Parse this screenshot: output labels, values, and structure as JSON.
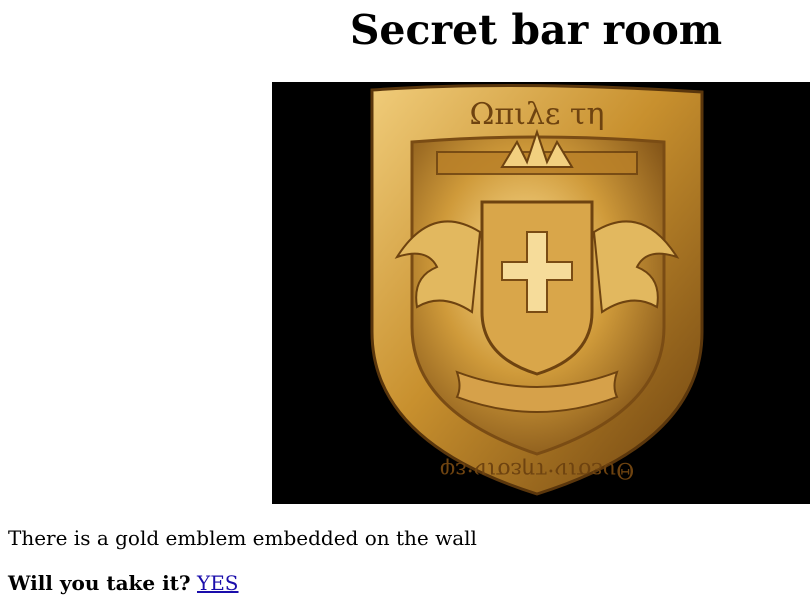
{
  "room": {
    "title": "Secret bar room"
  },
  "emblem": {
    "icon": "gold-shield-emblem-icon",
    "inscription_top": "Ωπιλε τη",
    "inscription_bottom": "Θυεσιν·τηεσιν·εφ",
    "colors": {
      "gold_light": "#f0cc7a",
      "gold_mid": "#c8902e",
      "gold_dark": "#6e4310",
      "background": "#000000"
    }
  },
  "description": "There is a gold emblem embedded on the wall",
  "prompt": {
    "question": "Will you take it?",
    "answer_link": "YES"
  },
  "colors": {
    "link": "#1a0dab"
  }
}
